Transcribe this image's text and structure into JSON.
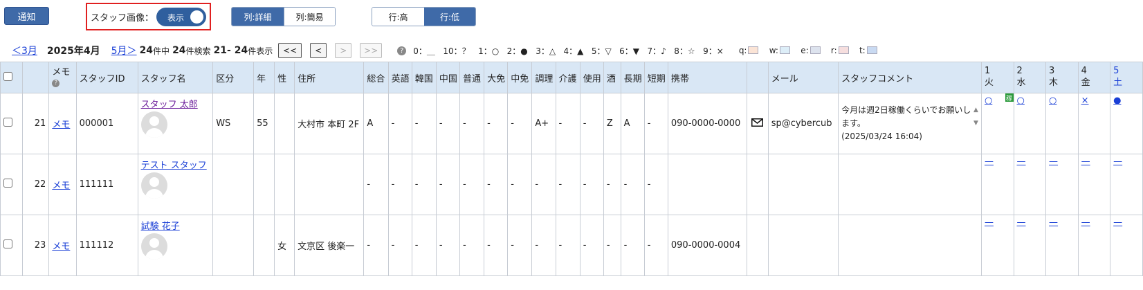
{
  "toolbar": {
    "notify_label": "通知",
    "staff_image_label": "スタッフ画像：",
    "staff_image_toggle": "表示",
    "col_detail": "列:詳細",
    "col_simple": "列:簡易",
    "row_high": "行:高",
    "row_low": "行:低"
  },
  "nav": {
    "prev_month": "＜3月",
    "current_month": "2025年4月",
    "next_month": "5月＞",
    "total": "24",
    "total_suffix": "件中",
    "search": "24",
    "search_suffix": "件検索",
    "range": "21- 24",
    "range_suffix": "件表示",
    "first": "<<",
    "prev": "<",
    "next": ">",
    "last": ">>"
  },
  "legend": [
    "0：＿",
    "10：？",
    "1：○",
    "2：●",
    "3：△",
    "4：▲",
    "5：▽",
    "6：▼",
    "7：♪",
    "8：☆",
    "9：×"
  ],
  "legend_colors": [
    {
      "label": "q:",
      "color": "#fbe4d6"
    },
    {
      "label": "w:",
      "color": "#ddeef8"
    },
    {
      "label": "e:",
      "color": "#dde3ee"
    },
    {
      "label": "r:",
      "color": "#f6dede"
    },
    {
      "label": "t:",
      "color": "#c9daf2"
    }
  ],
  "headers": {
    "memo": "メモ",
    "staff_id": "スタッフID",
    "staff_name": "スタッフ名",
    "category": "区分",
    "age": "年",
    "sex": "性",
    "address": "住所",
    "skills": [
      "総合",
      "英語",
      "韓国",
      "中国",
      "普通",
      "大免",
      "中免",
      "調理",
      "介護",
      "使用",
      "酒",
      "長期",
      "短期"
    ],
    "mobile": "携帯",
    "mail": "メール",
    "comment": "スタッフコメント",
    "days": [
      {
        "num": "1",
        "dow": "火"
      },
      {
        "num": "2",
        "dow": "水"
      },
      {
        "num": "3",
        "dow": "木"
      },
      {
        "num": "4",
        "dow": "金"
      },
      {
        "num": "5",
        "dow": "土"
      }
    ]
  },
  "rows": [
    {
      "no": "21",
      "memo": "メモ",
      "id": "000001",
      "name": "スタッフ 太郎",
      "category": "WS",
      "age": "55",
      "sex": "",
      "address": "大村市 本町 2F",
      "skills": [
        "A",
        "-",
        "-",
        "-",
        "-",
        "-",
        "-",
        "A+",
        "-",
        "-",
        "Z",
        "A",
        "-"
      ],
      "mobile": "090-0000-0000",
      "mail": "sp@cybercub",
      "comment": "今月は週2日稼働くらいでお願いします。",
      "comment_date": "(2025/03/24 16:04)",
      "days": [
        "○",
        "○",
        "○",
        "×",
        "●"
      ]
    },
    {
      "no": "22",
      "memo": "メモ",
      "id": "111111",
      "name": "テスト スタッフ",
      "category": "",
      "age": "",
      "sex": "",
      "address": "",
      "skills": [
        "-",
        "-",
        "-",
        "-",
        "-",
        "-",
        "-",
        "-",
        "-",
        "-",
        "-",
        "-",
        "-"
      ],
      "mobile": "",
      "mail": "",
      "comment": "",
      "comment_date": "",
      "days": [
        "—",
        "—",
        "—",
        "—",
        "—"
      ]
    },
    {
      "no": "23",
      "memo": "メモ",
      "id": "111112",
      "name": "試験 花子",
      "category": "",
      "age": "",
      "sex": "女",
      "address": "文京区 後楽一",
      "skills": [
        "-",
        "-",
        "-",
        "-",
        "-",
        "-",
        "-",
        "-",
        "-",
        "-",
        "-",
        "-",
        "-"
      ],
      "mobile": "090-0000-0004",
      "mail": "",
      "comment": "",
      "comment_date": "",
      "days": [
        "—",
        "—",
        "—",
        "—",
        "—"
      ]
    }
  ],
  "day_note": "稼"
}
